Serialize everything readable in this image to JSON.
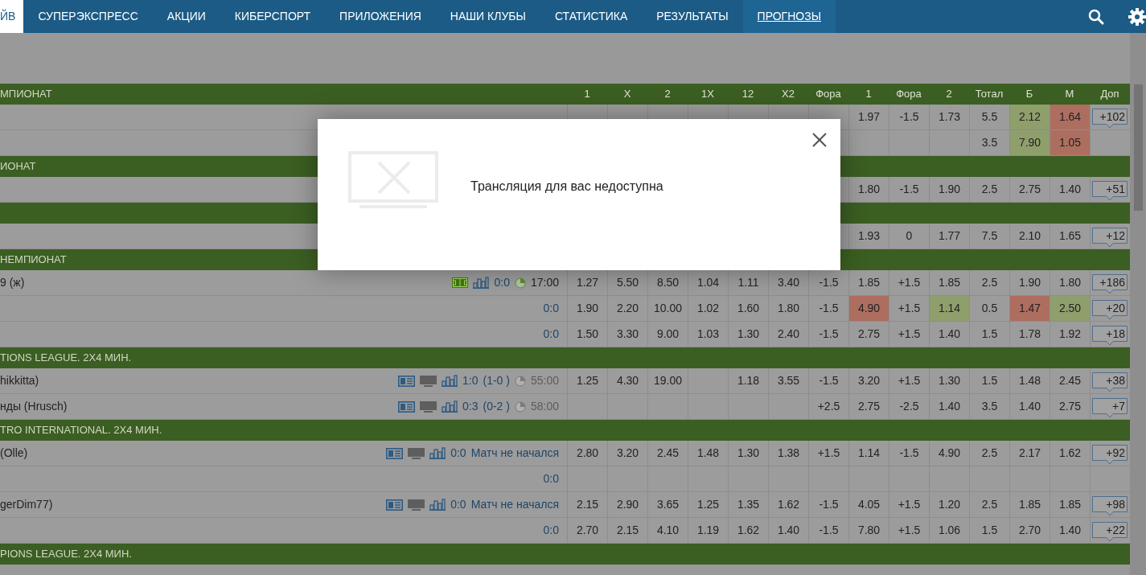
{
  "nav": {
    "items": [
      {
        "label": "ЙВ",
        "selected": true,
        "underlined": false
      },
      {
        "label": "СУПЕРЭКСПРЕСС",
        "selected": false,
        "underlined": false
      },
      {
        "label": "АКЦИИ",
        "selected": false,
        "underlined": false
      },
      {
        "label": "КИБЕРСПОРТ",
        "selected": false,
        "underlined": false
      },
      {
        "label": "ПРИЛОЖЕНИЯ",
        "selected": false,
        "underlined": false
      },
      {
        "label": "НАШИ КЛУБЫ",
        "selected": false,
        "underlined": false
      },
      {
        "label": "СТАТИСТИКА",
        "selected": false,
        "underlined": false
      },
      {
        "label": "РЕЗУЛЬТАТЫ",
        "selected": false,
        "underlined": false
      },
      {
        "label": "ПРОГНОЗЫ",
        "selected": false,
        "underlined": true
      }
    ]
  },
  "table": {
    "columns": [
      "1",
      "X",
      "2",
      "1X",
      "12",
      "X2",
      "Фора",
      "1",
      "Фора",
      "2",
      "Тотал",
      "Б",
      "М",
      "Доп"
    ],
    "sections": [
      {
        "title": "МПИОНАТ",
        "rows": [
          {
            "cells": [
              null,
              null,
              null,
              null,
              null,
              null,
              null,
              {
                "text": "1.97"
              },
              {
                "text": "-1.5"
              },
              {
                "text": "1.73"
              },
              {
                "text": "5.5"
              },
              {
                "text": "2.12",
                "color": "#8e9f6c"
              },
              {
                "text": "1.64",
                "color": "#ad6e60"
              }
            ],
            "more": "+102"
          },
          {
            "cells": [
              null,
              null,
              null,
              null,
              null,
              null,
              null,
              null,
              null,
              null,
              {
                "text": "3.5"
              },
              {
                "text": "7.90",
                "color": "#8e9f6c"
              },
              {
                "text": "1.05",
                "color": "#ad6e60"
              }
            ]
          }
        ]
      },
      {
        "title": "ИОНАТ",
        "rows": [
          {
            "cells": [
              null,
              null,
              null,
              null,
              null,
              null,
              null,
              {
                "text": "1.80"
              },
              {
                "text": "-1.5"
              },
              {
                "text": "1.90"
              },
              {
                "text": "2.5"
              },
              {
                "text": "2.75"
              },
              {
                "text": "1.40"
              }
            ],
            "more": "+51"
          }
        ]
      },
      {
        "rows": [
          {
            "cells": [
              null,
              null,
              null,
              null,
              null,
              null,
              null,
              {
                "text": "1.93"
              },
              {
                "text": "0"
              },
              {
                "text": "1.77"
              },
              {
                "text": "7.5"
              },
              {
                "text": "2.10"
              },
              {
                "text": "1.65"
              }
            ],
            "more": "+12"
          }
        ]
      },
      {
        "title": "НЕМПИОНАТ",
        "rows": [
          {
            "name": "9 (ж)",
            "icons": [
              {
                "kind": "field"
              },
              {
                "kind": "chart"
              }
            ],
            "score": "0:0",
            "clock": {
              "kind": "live"
            },
            "time": "17:00",
            "cells": [
              {
                "text": "1.27"
              },
              {
                "text": "5.50"
              },
              {
                "text": "8.50"
              },
              {
                "text": "1.04"
              },
              {
                "text": "1.11"
              },
              {
                "text": "3.40"
              },
              {
                "text": "-1.5"
              },
              {
                "text": "1.85"
              },
              {
                "text": "+1.5"
              },
              {
                "text": "1.85"
              },
              {
                "text": "2.5"
              },
              {
                "text": "1.90"
              },
              {
                "text": "1.80"
              }
            ],
            "more": "+186"
          },
          {
            "score": "0:0",
            "cells": [
              {
                "text": "1.90"
              },
              {
                "text": "2.20"
              },
              {
                "text": "10.00"
              },
              {
                "text": "1.02"
              },
              {
                "text": "1.60"
              },
              {
                "text": "1.80"
              },
              {
                "text": "-1.5"
              },
              {
                "text": "4.90",
                "color": "#ad6e60"
              },
              {
                "text": "+1.5"
              },
              {
                "text": "1.14",
                "color": "#8e9f6c"
              },
              {
                "text": "0.5"
              },
              {
                "text": "1.47",
                "color": "#ad6e60"
              },
              {
                "text": "2.50",
                "color": "#8e9f6c"
              }
            ],
            "more": "+20"
          },
          {
            "score": "0:0",
            "cells": [
              {
                "text": "1.50"
              },
              {
                "text": "3.30"
              },
              {
                "text": "9.00"
              },
              {
                "text": "1.03"
              },
              {
                "text": "1.30"
              },
              {
                "text": "2.40"
              },
              {
                "text": "-1.5"
              },
              {
                "text": "2.75"
              },
              {
                "text": "+1.5"
              },
              {
                "text": "1.40"
              },
              {
                "text": "1.5"
              },
              {
                "text": "1.78"
              },
              {
                "text": "1.92"
              }
            ],
            "more": "+18"
          }
        ]
      },
      {
        "title": "TIONS LEAGUE. 2X4 МИН.",
        "rows": [
          {
            "name": "hikkitta)",
            "icons": [
              {
                "kind": "scoreboard"
              },
              {
                "kind": "monitor"
              },
              {
                "kind": "chart"
              }
            ],
            "score": "1:0",
            "score_extra": "(1-0 )",
            "clock": {
              "kind": "paused"
            },
            "time": "55:00",
            "cells": [
              {
                "text": "1.25"
              },
              {
                "text": "4.30"
              },
              {
                "text": "19.00"
              },
              null,
              {
                "text": "1.18"
              },
              {
                "text": "3.55"
              },
              {
                "text": "-1.5"
              },
              {
                "text": "3.20"
              },
              {
                "text": "+1.5"
              },
              {
                "text": "1.30"
              },
              {
                "text": "1.5"
              },
              {
                "text": "1.48"
              },
              {
                "text": "2.45"
              }
            ],
            "more": "+38"
          },
          {
            "name": "нды (Hrusch)",
            "icons": [
              {
                "kind": "scoreboard"
              },
              {
                "kind": "monitor"
              },
              {
                "kind": "chart"
              }
            ],
            "score": "0:3",
            "score_extra": "(0-2 )",
            "clock": {
              "kind": "paused"
            },
            "time": "58:00",
            "cells": [
              null,
              null,
              null,
              null,
              null,
              null,
              {
                "text": "+2.5"
              },
              {
                "text": "2.75"
              },
              {
                "text": "-2.5"
              },
              {
                "text": "1.40"
              },
              {
                "text": "3.5"
              },
              {
                "text": "1.40"
              },
              {
                "text": "2.75"
              }
            ],
            "more": "+7"
          }
        ]
      },
      {
        "title": "TRO INTERNATIONAL. 2X4 МИН.",
        "rows": [
          {
            "name": "(Olle)",
            "icons": [
              {
                "kind": "scoreboard"
              },
              {
                "kind": "monitor"
              },
              {
                "kind": "chart"
              }
            ],
            "score": "0:0",
            "status": "Матч не начался",
            "cells": [
              {
                "text": "2.80"
              },
              {
                "text": "3.20"
              },
              {
                "text": "2.45"
              },
              {
                "text": "1.48"
              },
              {
                "text": "1.30"
              },
              {
                "text": "1.38"
              },
              {
                "text": "+1.5"
              },
              {
                "text": "1.14"
              },
              {
                "text": "-1.5"
              },
              {
                "text": "4.90"
              },
              {
                "text": "2.5"
              },
              {
                "text": "2.17"
              },
              {
                "text": "1.62"
              }
            ],
            "more": "+92"
          },
          {
            "score": "0:0",
            "cells": [
              null,
              null,
              null,
              null,
              null,
              null,
              null,
              null,
              null,
              null,
              null,
              null,
              null
            ]
          },
          {
            "name": "gerDim77)",
            "icons": [
              {
                "kind": "scoreboard"
              },
              {
                "kind": "monitor"
              },
              {
                "kind": "chart"
              }
            ],
            "score": "0:0",
            "status": "Матч не начался",
            "cells": [
              {
                "text": "2.15"
              },
              {
                "text": "2.90"
              },
              {
                "text": "3.65"
              },
              {
                "text": "1.25"
              },
              {
                "text": "1.35"
              },
              {
                "text": "1.62"
              },
              {
                "text": "-1.5"
              },
              {
                "text": "4.05"
              },
              {
                "text": "+1.5"
              },
              {
                "text": "1.20"
              },
              {
                "text": "2.5"
              },
              {
                "text": "1.85"
              },
              {
                "text": "1.85"
              }
            ],
            "more": "+98"
          },
          {
            "score": "0:0",
            "cells": [
              {
                "text": "2.70"
              },
              {
                "text": "2.15"
              },
              {
                "text": "4.10"
              },
              {
                "text": "1.19"
              },
              {
                "text": "1.62"
              },
              {
                "text": "1.40"
              },
              {
                "text": "-1.5"
              },
              {
                "text": "7.80"
              },
              {
                "text": "+1.5"
              },
              {
                "text": "1.06"
              },
              {
                "text": "1.5"
              },
              {
                "text": "2.70"
              },
              {
                "text": "1.40"
              }
            ],
            "more": "+22"
          }
        ]
      },
      {
        "title": "PIONS LEAGUE. 2X4 МИН."
      }
    ]
  },
  "modal": {
    "message": "Трансляция для вас недоступна"
  }
}
